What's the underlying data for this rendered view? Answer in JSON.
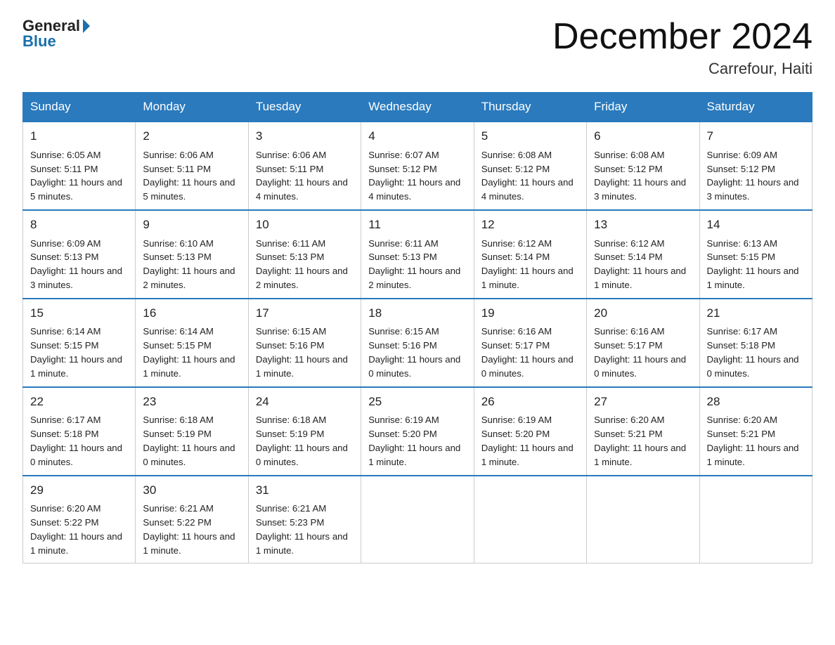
{
  "header": {
    "logo_general": "General",
    "logo_blue": "Blue",
    "month_title": "December 2024",
    "subtitle": "Carrefour, Haiti"
  },
  "days_of_week": [
    "Sunday",
    "Monday",
    "Tuesday",
    "Wednesday",
    "Thursday",
    "Friday",
    "Saturday"
  ],
  "weeks": [
    [
      {
        "day": "1",
        "sunrise": "6:05 AM",
        "sunset": "5:11 PM",
        "daylight": "11 hours and 5 minutes."
      },
      {
        "day": "2",
        "sunrise": "6:06 AM",
        "sunset": "5:11 PM",
        "daylight": "11 hours and 5 minutes."
      },
      {
        "day": "3",
        "sunrise": "6:06 AM",
        "sunset": "5:11 PM",
        "daylight": "11 hours and 4 minutes."
      },
      {
        "day": "4",
        "sunrise": "6:07 AM",
        "sunset": "5:12 PM",
        "daylight": "11 hours and 4 minutes."
      },
      {
        "day": "5",
        "sunrise": "6:08 AM",
        "sunset": "5:12 PM",
        "daylight": "11 hours and 4 minutes."
      },
      {
        "day": "6",
        "sunrise": "6:08 AM",
        "sunset": "5:12 PM",
        "daylight": "11 hours and 3 minutes."
      },
      {
        "day": "7",
        "sunrise": "6:09 AM",
        "sunset": "5:12 PM",
        "daylight": "11 hours and 3 minutes."
      }
    ],
    [
      {
        "day": "8",
        "sunrise": "6:09 AM",
        "sunset": "5:13 PM",
        "daylight": "11 hours and 3 minutes."
      },
      {
        "day": "9",
        "sunrise": "6:10 AM",
        "sunset": "5:13 PM",
        "daylight": "11 hours and 2 minutes."
      },
      {
        "day": "10",
        "sunrise": "6:11 AM",
        "sunset": "5:13 PM",
        "daylight": "11 hours and 2 minutes."
      },
      {
        "day": "11",
        "sunrise": "6:11 AM",
        "sunset": "5:13 PM",
        "daylight": "11 hours and 2 minutes."
      },
      {
        "day": "12",
        "sunrise": "6:12 AM",
        "sunset": "5:14 PM",
        "daylight": "11 hours and 1 minute."
      },
      {
        "day": "13",
        "sunrise": "6:12 AM",
        "sunset": "5:14 PM",
        "daylight": "11 hours and 1 minute."
      },
      {
        "day": "14",
        "sunrise": "6:13 AM",
        "sunset": "5:15 PM",
        "daylight": "11 hours and 1 minute."
      }
    ],
    [
      {
        "day": "15",
        "sunrise": "6:14 AM",
        "sunset": "5:15 PM",
        "daylight": "11 hours and 1 minute."
      },
      {
        "day": "16",
        "sunrise": "6:14 AM",
        "sunset": "5:15 PM",
        "daylight": "11 hours and 1 minute."
      },
      {
        "day": "17",
        "sunrise": "6:15 AM",
        "sunset": "5:16 PM",
        "daylight": "11 hours and 1 minute."
      },
      {
        "day": "18",
        "sunrise": "6:15 AM",
        "sunset": "5:16 PM",
        "daylight": "11 hours and 0 minutes."
      },
      {
        "day": "19",
        "sunrise": "6:16 AM",
        "sunset": "5:17 PM",
        "daylight": "11 hours and 0 minutes."
      },
      {
        "day": "20",
        "sunrise": "6:16 AM",
        "sunset": "5:17 PM",
        "daylight": "11 hours and 0 minutes."
      },
      {
        "day": "21",
        "sunrise": "6:17 AM",
        "sunset": "5:18 PM",
        "daylight": "11 hours and 0 minutes."
      }
    ],
    [
      {
        "day": "22",
        "sunrise": "6:17 AM",
        "sunset": "5:18 PM",
        "daylight": "11 hours and 0 minutes."
      },
      {
        "day": "23",
        "sunrise": "6:18 AM",
        "sunset": "5:19 PM",
        "daylight": "11 hours and 0 minutes."
      },
      {
        "day": "24",
        "sunrise": "6:18 AM",
        "sunset": "5:19 PM",
        "daylight": "11 hours and 0 minutes."
      },
      {
        "day": "25",
        "sunrise": "6:19 AM",
        "sunset": "5:20 PM",
        "daylight": "11 hours and 1 minute."
      },
      {
        "day": "26",
        "sunrise": "6:19 AM",
        "sunset": "5:20 PM",
        "daylight": "11 hours and 1 minute."
      },
      {
        "day": "27",
        "sunrise": "6:20 AM",
        "sunset": "5:21 PM",
        "daylight": "11 hours and 1 minute."
      },
      {
        "day": "28",
        "sunrise": "6:20 AM",
        "sunset": "5:21 PM",
        "daylight": "11 hours and 1 minute."
      }
    ],
    [
      {
        "day": "29",
        "sunrise": "6:20 AM",
        "sunset": "5:22 PM",
        "daylight": "11 hours and 1 minute."
      },
      {
        "day": "30",
        "sunrise": "6:21 AM",
        "sunset": "5:22 PM",
        "daylight": "11 hours and 1 minute."
      },
      {
        "day": "31",
        "sunrise": "6:21 AM",
        "sunset": "5:23 PM",
        "daylight": "11 hours and 1 minute."
      },
      null,
      null,
      null,
      null
    ]
  ],
  "labels": {
    "sunrise": "Sunrise:",
    "sunset": "Sunset:",
    "daylight": "Daylight:"
  }
}
